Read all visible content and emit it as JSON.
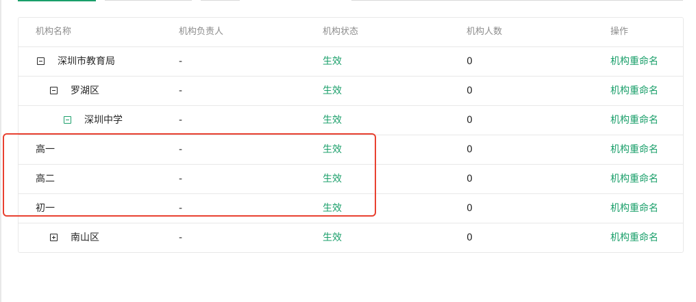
{
  "table": {
    "headers": [
      "机构名称",
      "机构负责人",
      "机构状态",
      "机构人数",
      "操作"
    ],
    "rows": [
      {
        "name": "深圳市教育局",
        "leader": "-",
        "status": "生效",
        "count": "0",
        "action": "机构重命名",
        "toggle": "minus"
      },
      {
        "name": "罗湖区",
        "leader": "-",
        "status": "生效",
        "count": "0",
        "action": "机构重命名",
        "toggle": "minus"
      },
      {
        "name": "深圳中学",
        "leader": "-",
        "status": "生效",
        "count": "0",
        "action": "机构重命名",
        "toggle": "minus"
      },
      {
        "name": "高一",
        "leader": "-",
        "status": "生效",
        "count": "0",
        "action": "机构重命名",
        "toggle": ""
      },
      {
        "name": "高二",
        "leader": "-",
        "status": "生效",
        "count": "0",
        "action": "机构重命名",
        "toggle": ""
      },
      {
        "name": "初一",
        "leader": "-",
        "status": "生效",
        "count": "0",
        "action": "机构重命名",
        "toggle": ""
      },
      {
        "name": "南山区",
        "leader": "-",
        "status": "生效",
        "count": "0",
        "action": "机构重命名",
        "toggle": "plus"
      }
    ]
  },
  "colors": {
    "accent": "#1a9f6a",
    "highlight": "#e8402f"
  }
}
